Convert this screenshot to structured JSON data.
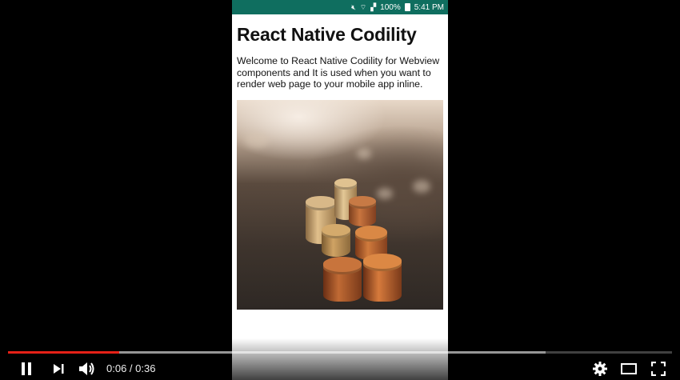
{
  "phone": {
    "status": {
      "battery": "100%",
      "time": "5:41 PM"
    },
    "title": "React Native Codility",
    "description": "Welcome to React Native Codility for Webview components and It is used when you want to render web page to your mobile app inline."
  },
  "player": {
    "current_time": "0:06",
    "separator": " / ",
    "duration": "0:36",
    "played_fraction": 0.167,
    "loaded_fraction": 0.81,
    "accent_color": "#e62117",
    "icons": [
      "pause-icon",
      "next-icon",
      "volume-icon",
      "settings-icon",
      "theater-mode-icon",
      "fullscreen-icon"
    ]
  }
}
